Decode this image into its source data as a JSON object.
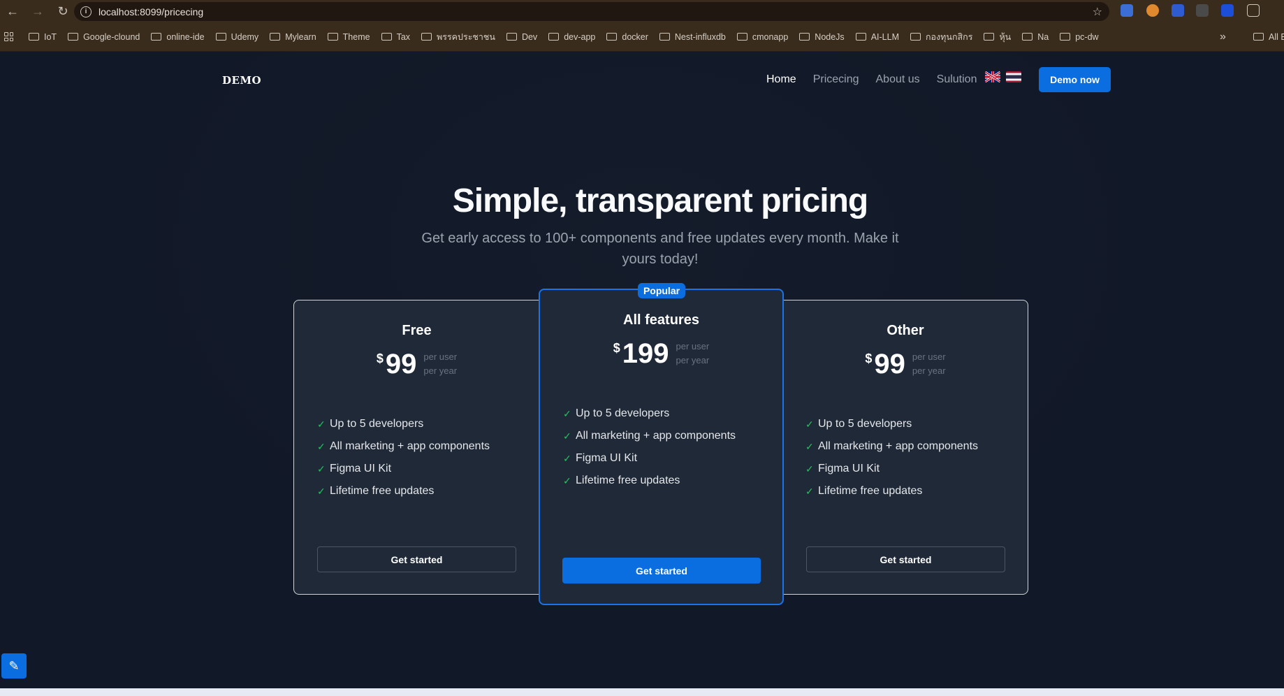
{
  "browser": {
    "url": "localhost:8099/pricecing",
    "bookmarks": [
      "IoT",
      "Google-clound",
      "online-ide",
      "Udemy",
      "Mylearn",
      "Theme",
      "Tax",
      "พรรคประชาชน",
      "Dev",
      "dev-app",
      "docker",
      "Nest-influxdb",
      "cmonapp",
      "NodeJs",
      "AI-LLM",
      "กองทุนกสิกร",
      "หุ้น",
      "Na",
      "pc-dw"
    ],
    "overflow_label": "»",
    "all_bookmarks_label": "All B"
  },
  "site": {
    "logo": "DEMO",
    "nav": [
      "Home",
      "Pricecing",
      "About us",
      "Sulution"
    ],
    "cta": "Demo now"
  },
  "hero": {
    "title": "Simple, transparent pricing",
    "subtitle": "Get early access to 100+ components and free updates every month. Make it yours today!"
  },
  "plans": [
    {
      "name": "Free",
      "currency": "$",
      "price": "99",
      "per_line1": "per user",
      "per_line2": "per year",
      "features": [
        "Up to 5 developers",
        "All marketing + app components",
        "Figma UI Kit",
        "Lifetime free updates"
      ],
      "button": "Get started"
    },
    {
      "name": "All features",
      "badge": "Popular",
      "currency": "$",
      "price": "199",
      "per_line1": "per user",
      "per_line2": "per year",
      "features": [
        "Up to 5 developers",
        "All marketing + app components",
        "Figma UI Kit",
        "Lifetime free updates"
      ],
      "button": "Get started"
    },
    {
      "name": "Other",
      "currency": "$",
      "price": "99",
      "per_line1": "per user",
      "per_line2": "per year",
      "features": [
        "Up to 5 developers",
        "All marketing + app components",
        "Figma UI Kit",
        "Lifetime free updates"
      ],
      "button": "Get started"
    }
  ],
  "colors": {
    "accent": "#0a6ee0",
    "page_bg": "#111827",
    "card_bg": "#1f2937",
    "check": "#22c55e"
  }
}
